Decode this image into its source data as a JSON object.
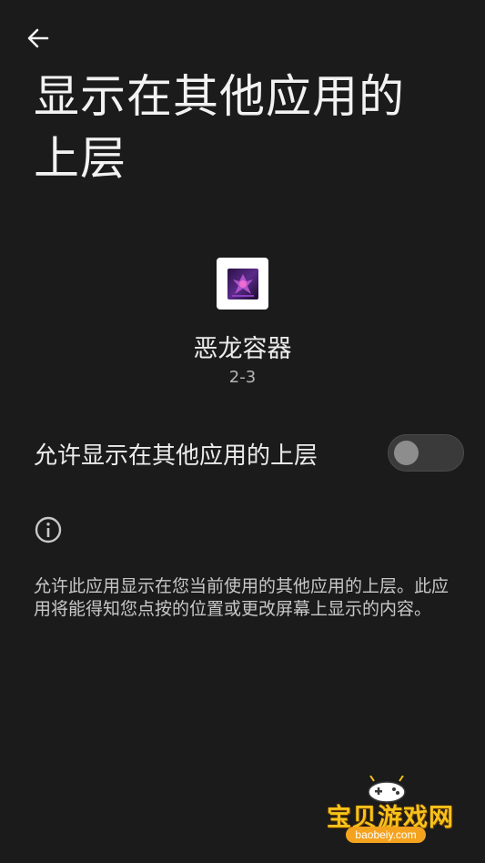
{
  "header": {
    "back_icon": "arrow-left-icon",
    "title": "显示在其他应用的上层"
  },
  "app": {
    "name": "恶龙容器",
    "version": "2-3"
  },
  "permission": {
    "label": "允许显示在其他应用的上层",
    "enabled": false
  },
  "info": {
    "icon": "info-icon",
    "text": "允许此应用显示在您当前使用的其他应用的上层。此应用将能得知您点按的位置或更改屏幕上显示的内容。"
  },
  "watermark": {
    "text": "宝贝游戏网",
    "url": "baobeiy.com"
  },
  "colors": {
    "background": "#1b1b1b",
    "text_primary": "#ececec",
    "text_secondary": "#b5b5b5",
    "switch_track_off": "#3a3a3a",
    "switch_thumb_off": "#8d8d8d",
    "watermark_yellow": "#f7c21a"
  }
}
